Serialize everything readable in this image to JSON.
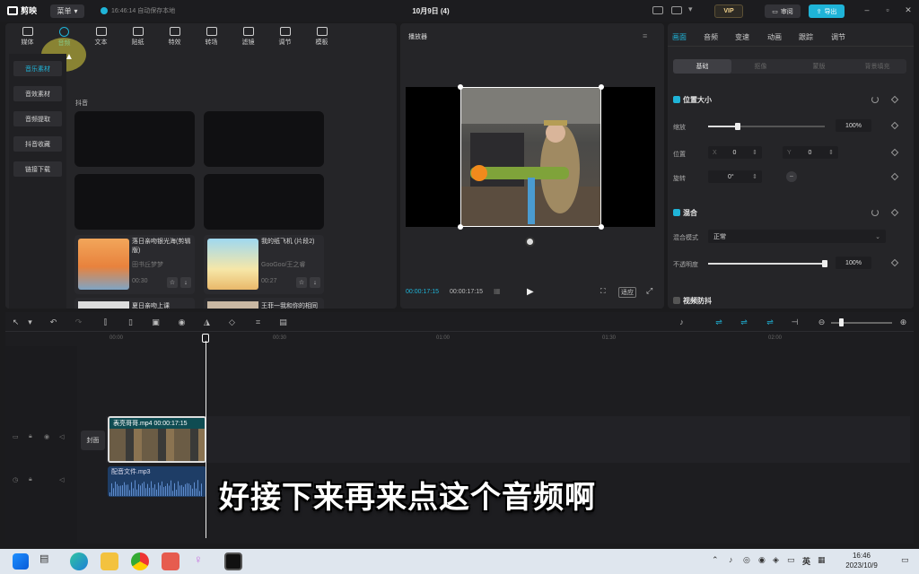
{
  "app": {
    "name": "剪映",
    "menu_label": "菜单",
    "autosave": "16:46:14 自动保存本地",
    "project_title": "10月9日 (4)",
    "vip_label": "VIP",
    "review_label": "审阅",
    "export_label": "导出"
  },
  "tool_tabs": [
    {
      "label": "媒体",
      "icon": "media-icon"
    },
    {
      "label": "音频",
      "icon": "audio-icon"
    },
    {
      "label": "文本",
      "icon": "text-icon"
    },
    {
      "label": "贴纸",
      "icon": "sticker-icon"
    },
    {
      "label": "特效",
      "icon": "effects-icon"
    },
    {
      "label": "转场",
      "icon": "transition-icon"
    },
    {
      "label": "滤镜",
      "icon": "filter-icon"
    },
    {
      "label": "调节",
      "icon": "adjust-icon"
    },
    {
      "label": "模板",
      "icon": "template-icon"
    }
  ],
  "side_nav": [
    "音乐素材",
    "音效素材",
    "音频提取",
    "抖音收藏",
    "链接下载"
  ],
  "section_label": "抖音",
  "music_items": [
    {
      "title": "落日亲吻银光海(剪辑版)",
      "author": "田书丘梦梦",
      "duration": "00:30"
    },
    {
      "title": "我的纸飞机 (片段2)",
      "author": "GooGoo/王之睿",
      "duration": "00:27"
    },
    {
      "title": "夏日亲吻上课",
      "author": "",
      "duration": ""
    },
    {
      "title": "王菲一我和你的相同",
      "author": "",
      "duration": ""
    }
  ],
  "player": {
    "title": "播放器",
    "current_time": "00:00:17:15",
    "total_time": "00:00:17:15",
    "ratio_label": "适应"
  },
  "props": {
    "tabs": [
      "画面",
      "音频",
      "变速",
      "动画",
      "跟踪",
      "调节"
    ],
    "segments": [
      "基础",
      "抠像",
      "蒙版",
      "背景填充"
    ],
    "position_size_label": "位置大小",
    "scale_label": "缩放",
    "scale_value": "100%",
    "scale_level": 0.25,
    "position_label": "位置",
    "x_label": "X",
    "x_value": "0",
    "y_label": "Y",
    "y_value": "0",
    "rotate_label": "旋转",
    "rotate_value": "0°",
    "blend_label": "混合",
    "blend_mode_label": "混合模式",
    "blend_mode_value": "正常",
    "opacity_label": "不透明度",
    "opacity_value": "100%",
    "opacity_level": 1.0,
    "stabilize_label": "视频防抖"
  },
  "timeline": {
    "ruler": [
      "00:00",
      "00:30",
      "01:00",
      "01:30",
      "02:00"
    ],
    "cover_label": "封面",
    "video_clip_name": "表亮哥哥.mp4",
    "video_clip_time": "00:00:17:15",
    "audio_clip_name": "配音文件.mp3",
    "subtitle": "好接下来再来点这个音频啊"
  },
  "taskbar": {
    "time": "16:46",
    "date": "2023/10/9",
    "lang": "英"
  },
  "colors": {
    "accent": "#1fb4d8",
    "panel": "#252528",
    "background": "#1b1b1d"
  }
}
